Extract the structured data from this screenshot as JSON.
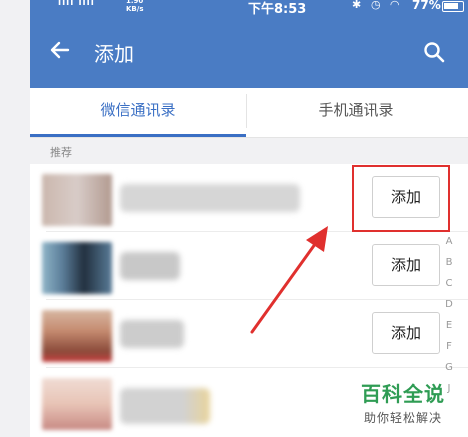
{
  "status_bar": {
    "signal_text": "ıııl ıııl",
    "speed_text": "1.90\nKB/s",
    "time": "下午8:53",
    "status_icons": "✱ ◷ ◠",
    "battery": "77%"
  },
  "app_bar": {
    "back_icon": "back-arrow-icon",
    "title": "添加",
    "search_icon": "search-icon"
  },
  "tabs": [
    {
      "label": "微信通讯录",
      "active": true
    },
    {
      "label": "手机通讯录",
      "active": false
    }
  ],
  "section_label": "推荐",
  "contacts": [
    {
      "avatar_colors": [
        "#cbb7ad",
        "#d8ccc8",
        "#b29a90"
      ],
      "name_color": "#d6d6d6",
      "button_label": "添加"
    },
    {
      "avatar_colors": [
        "#5a7c98",
        "#22303f",
        "#8fb5c8"
      ],
      "name_color": "#c8c8c8",
      "button_label": "添加"
    },
    {
      "avatar_colors": [
        "#c58b70",
        "#8a4a3a",
        "#d7b7a2"
      ],
      "name_color": "#cccccc",
      "button_label": "添加"
    },
    {
      "avatar_colors": [
        "#e8c4b6",
        "#c88a84",
        "#f0dcd4"
      ],
      "name_color": "#d2d2d2",
      "extra_color": "#e8d39a"
    }
  ],
  "index_letters": [
    "A",
    "B",
    "C",
    "D",
    "E",
    "F",
    "G",
    "J"
  ],
  "colors": {
    "header_blue": "#4a7cc4",
    "tab_active_blue": "#3a6fc4",
    "highlight_red": "#e0302e",
    "watermark_green": "#2f9c54"
  },
  "watermark": {
    "main": "百科全说",
    "sub": "助你轻松解决"
  }
}
